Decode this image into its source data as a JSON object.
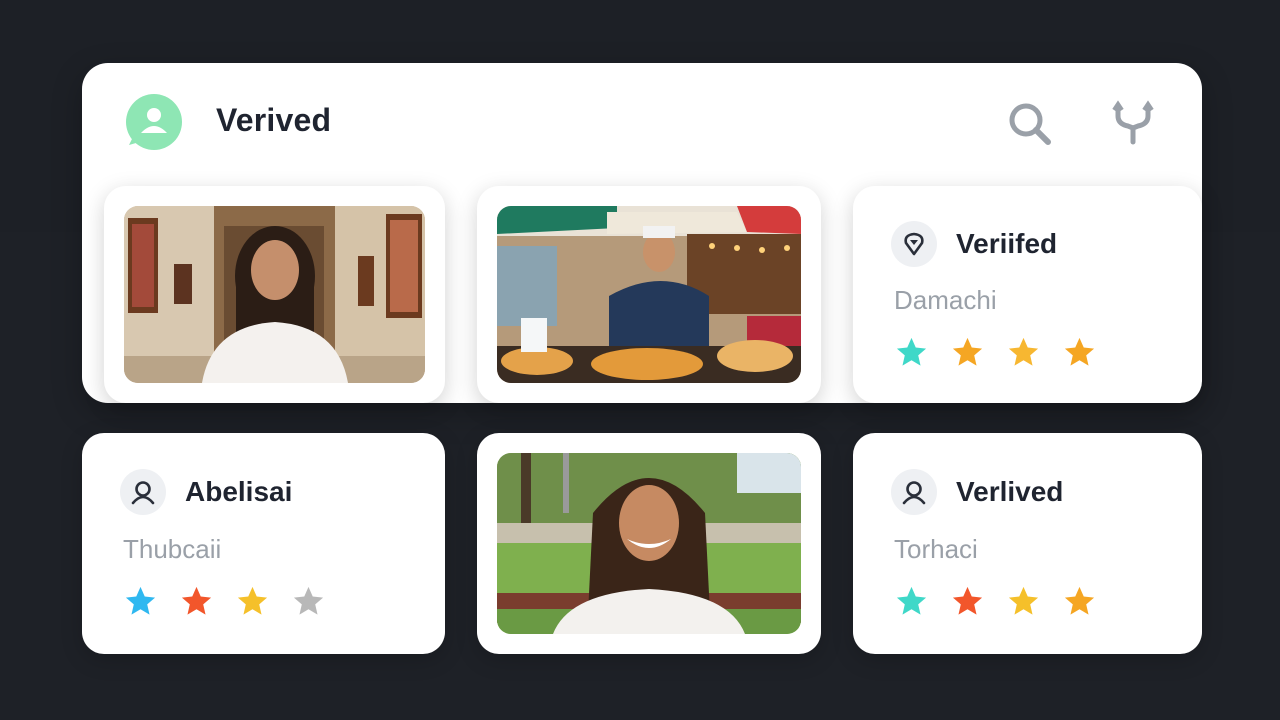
{
  "header": {
    "title": "Verived",
    "avatar_icon": "user-chat-icon",
    "avatar_color": "#8ee6b4",
    "search_icon": "search-icon",
    "filter_icon": "fork-icon"
  },
  "cards": [
    {
      "type": "photo",
      "subject": "woman-in-gallery"
    },
    {
      "type": "photo",
      "subject": "market-vendor"
    },
    {
      "type": "info",
      "icon": "location-pin-icon",
      "title": "Veriifed",
      "subtitle": "Damachi",
      "rating": 4,
      "star_colors": [
        "#3fd8c8",
        "#f5a623",
        "#f7b731",
        "#f5a623"
      ]
    },
    {
      "type": "info",
      "icon": "user-icon",
      "title": "Abelisai",
      "subtitle": "Thubcaii",
      "rating": 3,
      "star_colors": [
        "#2fb8f0",
        "#f2562b",
        "#f5c02a",
        "#b8b8b8"
      ]
    },
    {
      "type": "photo",
      "subject": "smiling-man-park"
    },
    {
      "type": "info",
      "icon": "user-icon",
      "title": "Verlived",
      "subtitle": "Torhaci",
      "rating": 4,
      "star_colors": [
        "#3fd8c8",
        "#f2562b",
        "#f5c02a",
        "#f5a623"
      ]
    }
  ]
}
